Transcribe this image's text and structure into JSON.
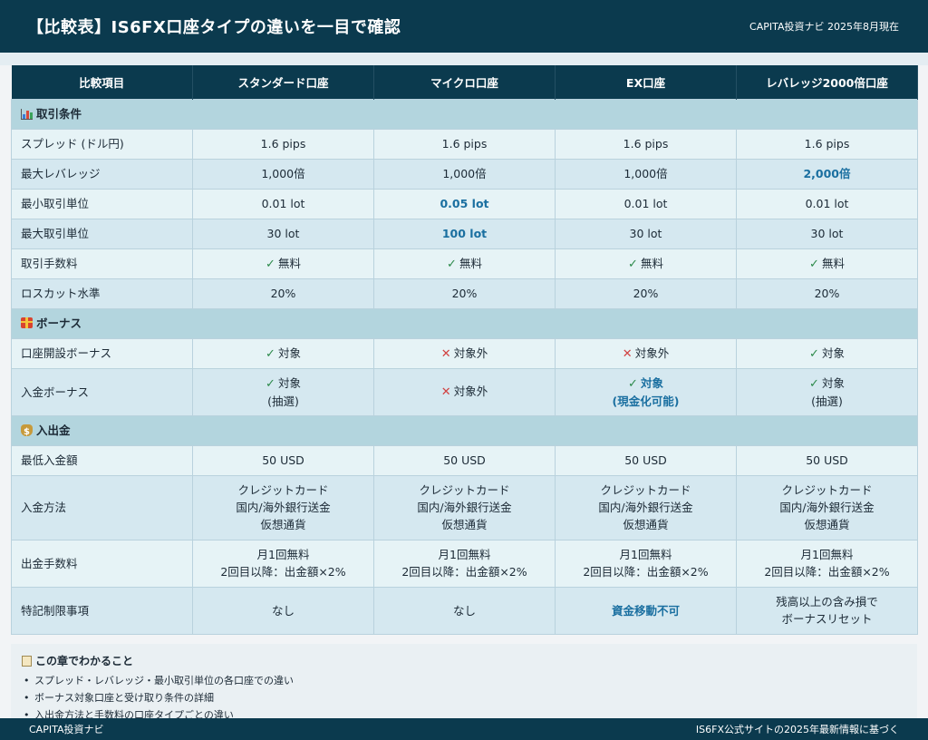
{
  "header": {
    "title": "【比較表】IS6FX口座タイプの違いを一目で確認",
    "meta": "CAPITA投資ナビ 2025年8月現在"
  },
  "table": {
    "columns": [
      "比較項目",
      "スタンダード口座",
      "マイクロ口座",
      "EX口座",
      "レバレッジ2000倍口座"
    ],
    "sections": {
      "trading": "取引条件",
      "bonus": "ボーナス",
      "funds": "入出金"
    },
    "rows": {
      "spread": {
        "label": "スプレッド (ドル円)",
        "values": [
          "1.6 pips",
          "1.6 pips",
          "1.6 pips",
          "1.6 pips"
        ]
      },
      "max_leverage": {
        "label": "最大レバレッジ",
        "values": [
          "1,000倍",
          "1,000倍",
          "1,000倍",
          "2,000倍"
        ]
      },
      "min_lot": {
        "label": "最小取引単位",
        "values": [
          "0.01 lot",
          "0.05 lot",
          "0.01 lot",
          "0.01 lot"
        ]
      },
      "max_lot": {
        "label": "最大取引単位",
        "values": [
          "30 lot",
          "100 lot",
          "30 lot",
          "30 lot"
        ]
      },
      "fee": {
        "label": "取引手数料",
        "values": [
          "無料",
          "無料",
          "無料",
          "無料"
        ]
      },
      "losscut": {
        "label": "ロスカット水準",
        "values": [
          "20%",
          "20%",
          "20%",
          "20%"
        ]
      },
      "open_bonus": {
        "label": "口座開設ボーナス",
        "values": [
          "対象",
          "対象外",
          "対象外",
          "対象"
        ]
      },
      "deposit_bonus": {
        "label": "入金ボーナス",
        "values": [
          "対象",
          "対象外",
          "対象",
          "対象"
        ],
        "notes": [
          "(抽選)",
          "",
          "(現金化可能)",
          "(抽選)"
        ]
      },
      "min_deposit": {
        "label": "最低入金額",
        "values": [
          "50 USD",
          "50 USD",
          "50 USD",
          "50 USD"
        ]
      },
      "deposit_method": {
        "label": "入金方法",
        "lines": [
          "クレジットカード",
          "国内/海外銀行送金",
          "仮想通貨"
        ]
      },
      "withdraw_fee": {
        "label": "出金手数料",
        "lines": [
          "月1回無料",
          "2回目以降：出金額×2%"
        ]
      },
      "restrictions": {
        "label": "特記制限事項",
        "values": [
          "なし",
          "なし",
          "資金移動不可",
          "残高以上の含み損で"
        ],
        "values2": [
          "",
          "",
          "",
          "ボーナスリセット"
        ]
      }
    }
  },
  "notes": {
    "title": "この章でわかること",
    "items": [
      "スプレッド・レバレッジ・最小取引単位の各口座での違い",
      "ボーナス対象口座と受け取り条件の詳細",
      "入出金方法と手数料の口座タイプごとの違い"
    ]
  },
  "footer": {
    "left": "CAPITA投資ナビ",
    "right": "IS6FX公式サイトの2025年最新情報に基づく"
  },
  "colors": {
    "header_bg": "#0b3a4e",
    "section_bg": "#b3d5de",
    "highlight": "#1a6fa0",
    "check": "#2c8a4a",
    "cross": "#d14040"
  },
  "icons": {
    "trading": "bar-chart-icon",
    "bonus": "gift-icon",
    "funds": "money-bag-icon",
    "notes": "memo-icon",
    "yes": "check-icon",
    "no": "cross-icon"
  }
}
